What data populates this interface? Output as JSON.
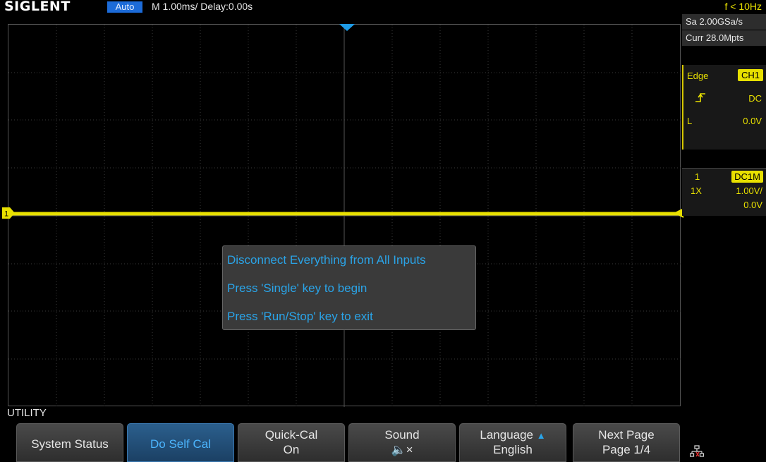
{
  "topbar": {
    "logo": "SIGLENT",
    "mode": "Auto",
    "timebase": "M 1.00ms/ Delay:0.00s",
    "frequency": "f < 10Hz"
  },
  "acquisition": {
    "sample_rate": "Sa 2.00GSa/s",
    "memory_depth": "Curr 28.0Mpts"
  },
  "trigger": {
    "type": "Edge",
    "source": "CH1",
    "slope_icon": "rising-edge-icon",
    "coupling": "DC",
    "level_label": "L",
    "level_value": "0.0V"
  },
  "channel1": {
    "number": "1",
    "coupling_impedance": "DC1M",
    "probe": "1X",
    "scale": "1.00V/",
    "offset": "0.0V",
    "marker": "1"
  },
  "dialog": {
    "line1": "Disconnect Everything from All Inputs",
    "line2": "Press 'Single' key to begin",
    "line3": "Press 'Run/Stop' key to exit"
  },
  "menu": {
    "title": "UTILITY",
    "softkeys": {
      "system_status": "System Status",
      "do_self_cal": "Do Self Cal",
      "quick_cal_label": "Quick-Cal",
      "quick_cal_value": "On",
      "sound_label": "Sound",
      "sound_value": "🔈×",
      "language_label": "Language",
      "language_value": "English",
      "next_page_label": "Next Page",
      "next_page_value": "Page 1/4"
    },
    "icons": {
      "language": "up-arrow-icon",
      "network": "network-disconnected-icon"
    }
  },
  "colors": {
    "ch1": "#e8e000",
    "accent": "#2aa4e8",
    "mode_bg": "#1c6bd8"
  }
}
